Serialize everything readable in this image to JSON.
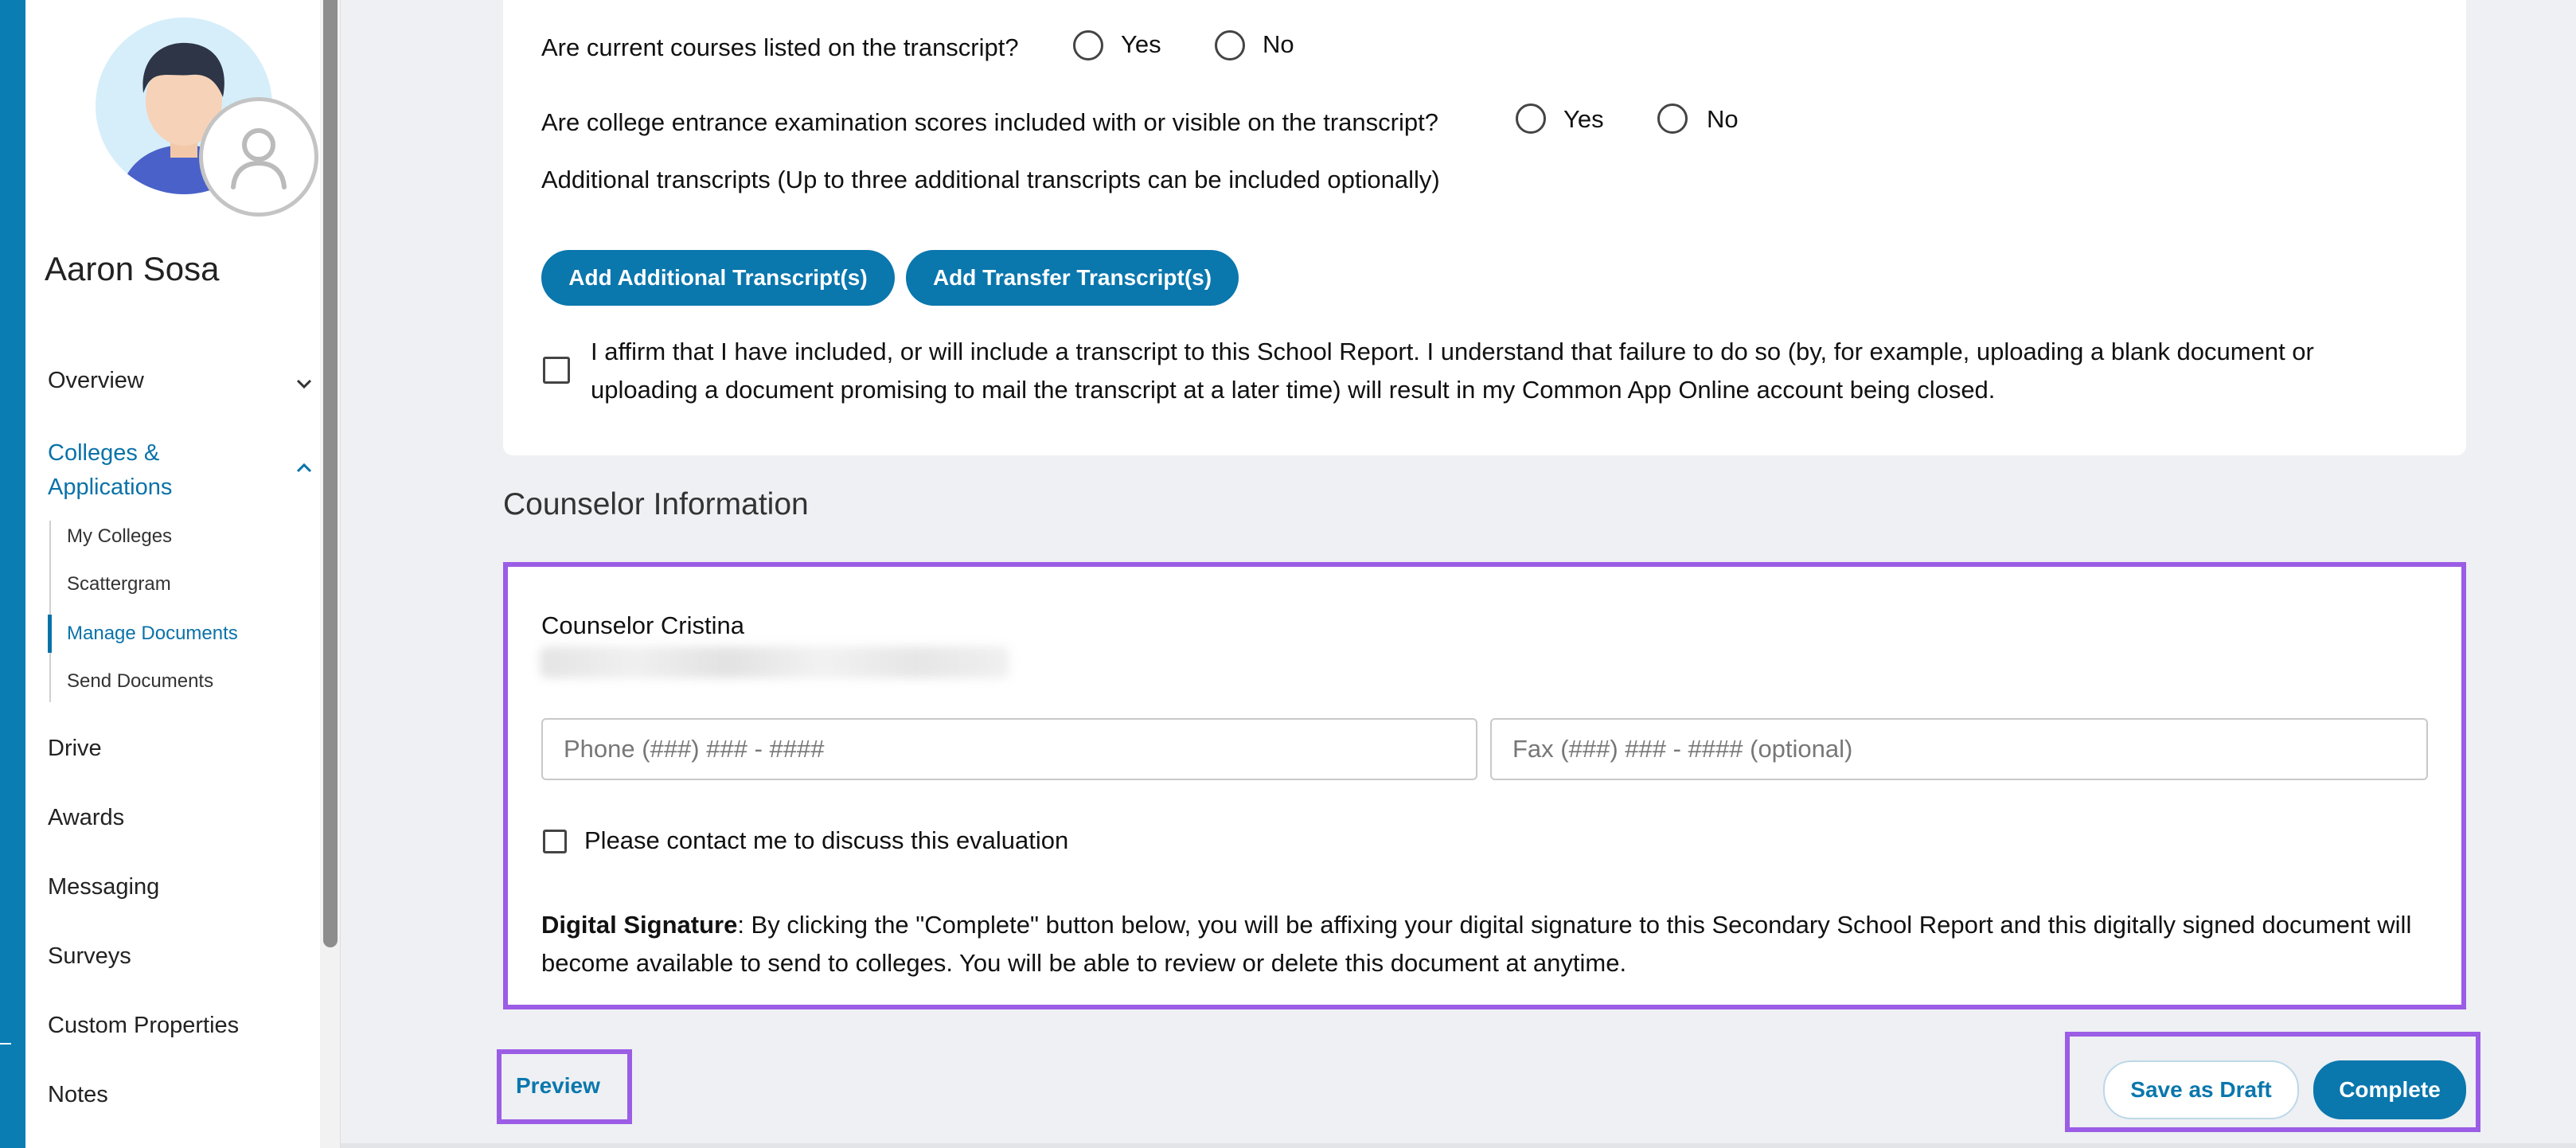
{
  "sidebar": {
    "user_name": "Aaron Sosa",
    "nav": {
      "overview": "Overview",
      "colleges_line1": "Colleges &",
      "colleges_line2": "Applications",
      "drive": "Drive",
      "awards": "Awards",
      "messaging": "Messaging",
      "surveys": "Surveys",
      "custom_properties": "Custom Properties",
      "notes": "Notes"
    },
    "sub": {
      "my_colleges": "My Colleges",
      "scattergram": "Scattergram",
      "manage_documents": "Manage Documents",
      "send_documents": "Send Documents"
    }
  },
  "transcript": {
    "q_current_courses": "Are current courses listed on the transcript?",
    "q_exam_scores": "Are college entrance examination scores included with or visible on the transcript?",
    "yes": "Yes",
    "no": "No",
    "additional_note": "Additional transcripts (Up to three additional transcripts can be included optionally)",
    "add_additional": "Add Additional Transcript(s)",
    "add_transfer": "Add Transfer Transcript(s)",
    "affirm": "I affirm that I have included, or will include a transcript to this School Report. I understand that failure to do so (by, for example, uploading a blank document or uploading a document promising to mail the transcript at a later time) will result in my Common App Online account being closed."
  },
  "counselor": {
    "section_title": "Counselor Information",
    "name": "Counselor Cristina",
    "phone_placeholder": "Phone (###) ### - ####",
    "fax_placeholder": "Fax (###) ### - #### (optional)",
    "contact_label": "Please contact me to discuss this evaluation",
    "signature_bold": "Digital Signature",
    "signature_text": ": By clicking the \"Complete\" button below, you will be affixing your digital signature to this Secondary School Report and this digitally signed document will become available to send to colleges. You will be able to review or delete this document at anytime."
  },
  "actions": {
    "preview": "Preview",
    "save_draft": "Save as Draft",
    "complete": "Complete"
  },
  "colors": {
    "accent": "#0a77ad",
    "highlight": "#9b5de5"
  }
}
